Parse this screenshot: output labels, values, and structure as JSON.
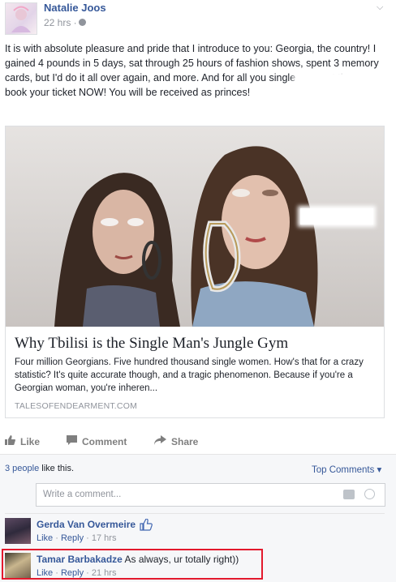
{
  "post": {
    "author": "Natalie Joos",
    "timestamp": "22 hrs ·",
    "body": "It is with absolute pleasure and pride that I introduce to you: Georgia, the country! I gained 4 pounds in 5 days, sat through 25 hours of fashion shows, spent 3 memory cards, but I'd do it all over again, and more. And for all you single men out there: book your ticket NOW! You will be received as princes!"
  },
  "card": {
    "title": "Why Tbilisi is the Single Man's Jungle Gym",
    "description": "Four million Georgians. Five hundred thousand single women. How's that for a crazy statistic? It's quite accurate though, and a tragic phenomenon. Because if you're a Georgian woman, you're inheren...",
    "domain": "TALESOFENDEARMENT.COM"
  },
  "actions": {
    "like": "Like",
    "comment": "Comment",
    "share": "Share"
  },
  "likes": {
    "count_text": "3 people",
    "suffix": " like this."
  },
  "top_comments": "Top Comments ▾",
  "comment_input": {
    "placeholder": "Write a comment..."
  },
  "comments": [
    {
      "name": "Gerda Van Overmeire",
      "text": "",
      "like": "Like",
      "reply": "Reply",
      "time": "17 hrs"
    },
    {
      "name": "Tamar Barbakadze",
      "text": "As always, ur totally right))",
      "like": "Like",
      "reply": "Reply",
      "time": "21 hrs"
    }
  ],
  "colors": {
    "link": "#365899",
    "highlight_border": "#e3192d"
  }
}
